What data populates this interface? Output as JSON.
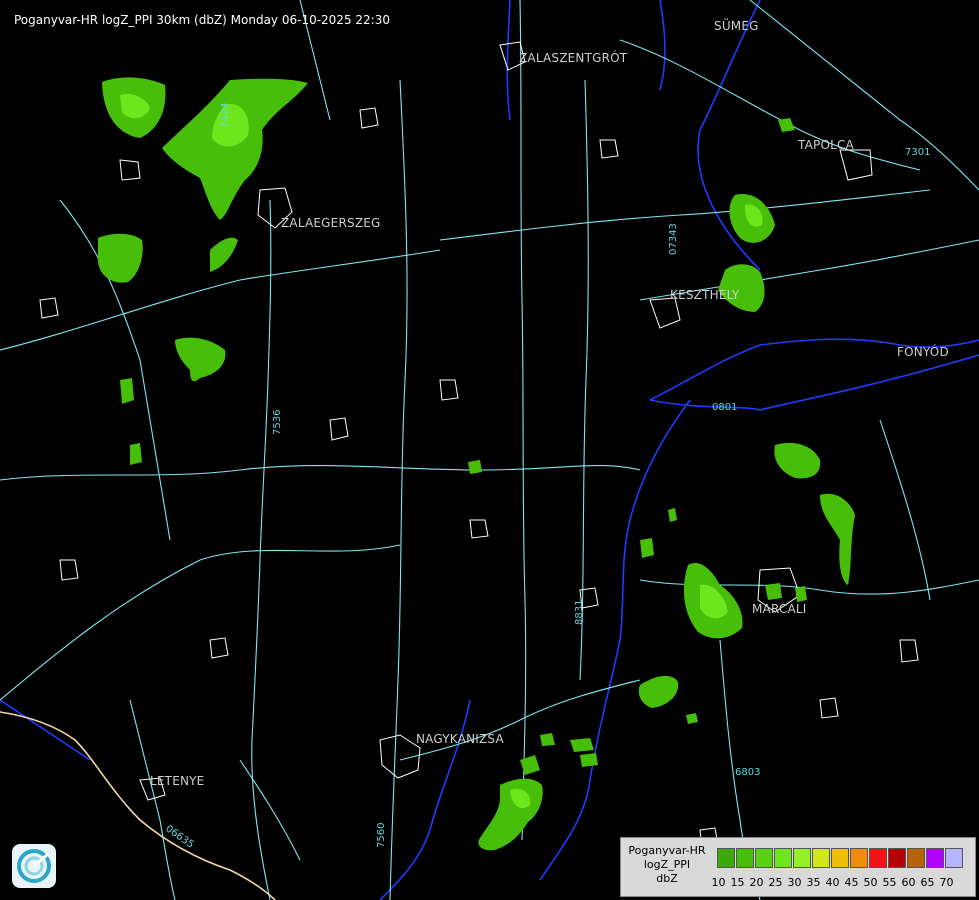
{
  "title": "Poganyvar-HR logZ_PPI 30km (dbZ) Monday 06-10-2025 22:30",
  "cities": [
    {
      "name": "SÜMEG"
    },
    {
      "name": "ZALASZENTGRÓT"
    },
    {
      "name": "TAPOLCA"
    },
    {
      "name": "ZALAEGERSZEG"
    },
    {
      "name": "KESZTHELY"
    },
    {
      "name": "FONYÓD"
    },
    {
      "name": "MARCALI"
    },
    {
      "name": "NAGYKANIZSA"
    },
    {
      "name": "LETENYE"
    }
  ],
  "legend": {
    "line1": "Poganyvar-HR",
    "line2": "logZ_PPI",
    "line3": "dbZ",
    "levels": [
      "10",
      "15",
      "20",
      "25",
      "30",
      "35",
      "40",
      "45",
      "50",
      "55",
      "60",
      "65",
      "70"
    ],
    "colors": [
      "#3caa0a",
      "#46be0a",
      "#5ad214",
      "#6ee61e",
      "#96f028",
      "#d2e61e",
      "#f0be0a",
      "#f08c0a",
      "#f01414",
      "#b40000",
      "#b4640a",
      "#b400ff",
      "#b4b4ff"
    ]
  },
  "colors": {
    "roads": "#7fe8f0",
    "borders": "#ffffff",
    "water": "#1e3cff",
    "echo_weak": "#46be0a",
    "echo_mid": "#6ee61e"
  }
}
